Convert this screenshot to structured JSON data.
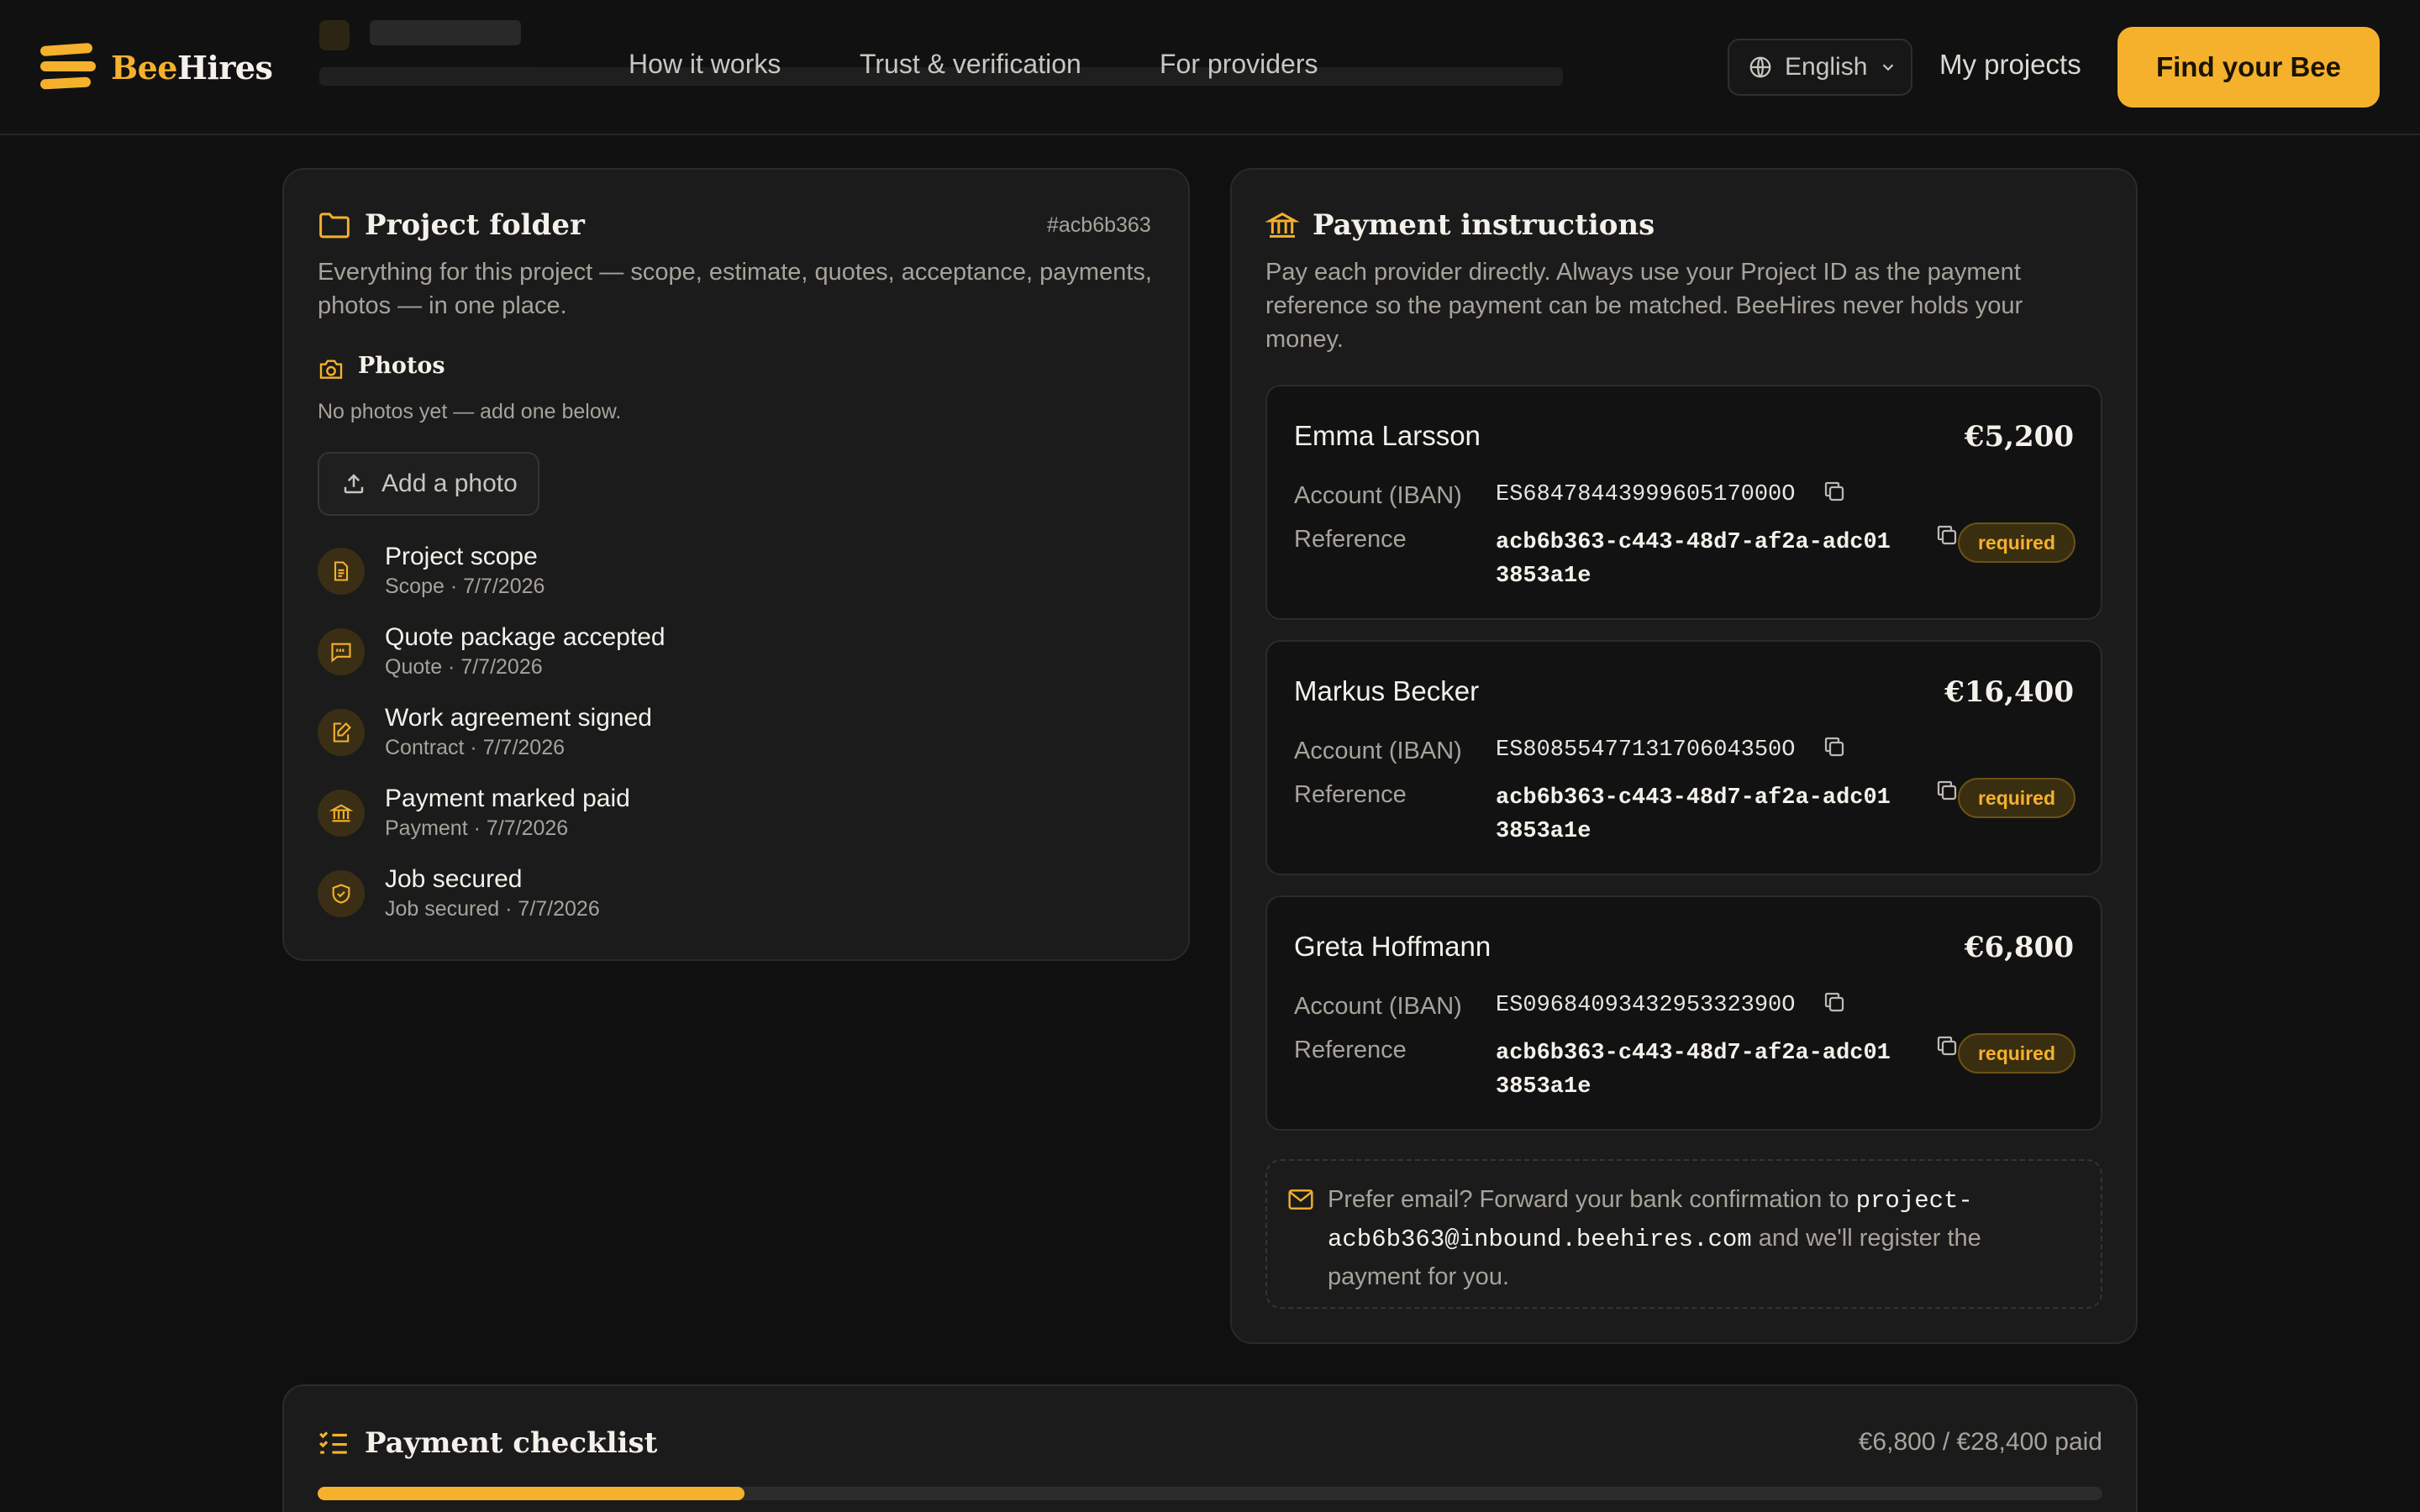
{
  "header": {
    "logo": {
      "bee": "Bee",
      "hires": "Hires"
    },
    "nav": [
      {
        "label": "How it works"
      },
      {
        "label": "Trust & verification"
      },
      {
        "label": "For providers"
      }
    ],
    "language": "English",
    "my_projects": "My projects",
    "cta": "Find your Bee"
  },
  "folder": {
    "title": "Project folder",
    "id": "#acb6b363",
    "description": "Everything for this project — scope, estimate, quotes, acceptance, payments, photos — in one place.",
    "photos_label": "Photos",
    "no_photos": "No photos yet — add one below.",
    "add_photo": "Add a photo",
    "timeline": [
      {
        "title": "Project scope",
        "sub": "Scope · 7/7/2026",
        "icon": "document-icon"
      },
      {
        "title": "Quote package accepted",
        "sub": "Quote · 7/7/2026",
        "icon": "quote-icon"
      },
      {
        "title": "Work agreement signed",
        "sub": "Contract · 7/7/2026",
        "icon": "signature-icon"
      },
      {
        "title": "Payment marked paid",
        "sub": "Payment · 7/7/2026",
        "icon": "bank-icon"
      },
      {
        "title": "Job secured",
        "sub": "Job secured · 7/7/2026",
        "icon": "shield-check-icon"
      }
    ]
  },
  "payment": {
    "title": "Payment instructions",
    "description": "Pay each provider directly. Always use your Project ID as the payment reference so the payment can be matched. BeeHires never holds your money.",
    "account_label": "Account (IBAN)",
    "reference_label": "Reference",
    "required_label": "required",
    "providers": [
      {
        "name": "Emma Larsson",
        "amount": "€5,200",
        "iban": "ES6847844399960517000O",
        "reference_1": "acb6b363-c443-48d7-af2a-adc01",
        "reference_2": "3853a1e"
      },
      {
        "name": "Markus Becker",
        "amount": "€16,400",
        "iban": "ES8085547713170604350O",
        "reference_1": "acb6b363-c443-48d7-af2a-adc01",
        "reference_2": "3853a1e"
      },
      {
        "name": "Greta Hoffmann",
        "amount": "€6,800",
        "iban": "ES0968409343295332390O",
        "reference_1": "acb6b363-c443-48d7-af2a-adc01",
        "reference_2": "3853a1e"
      }
    ],
    "email_prefix": "Prefer email? Forward your bank confirmation to ",
    "email_address": "project-acb6b363@inbound.beehires.com",
    "email_suffix": " and we'll register the payment for you."
  },
  "checklist": {
    "title": "Payment checklist",
    "paid_text": "€6,800 / €28,400 paid",
    "paid_fraction": 0.2394
  },
  "colors": {
    "accent": "#f5b12c",
    "background": "#101010",
    "card": "#1b1b1b"
  }
}
